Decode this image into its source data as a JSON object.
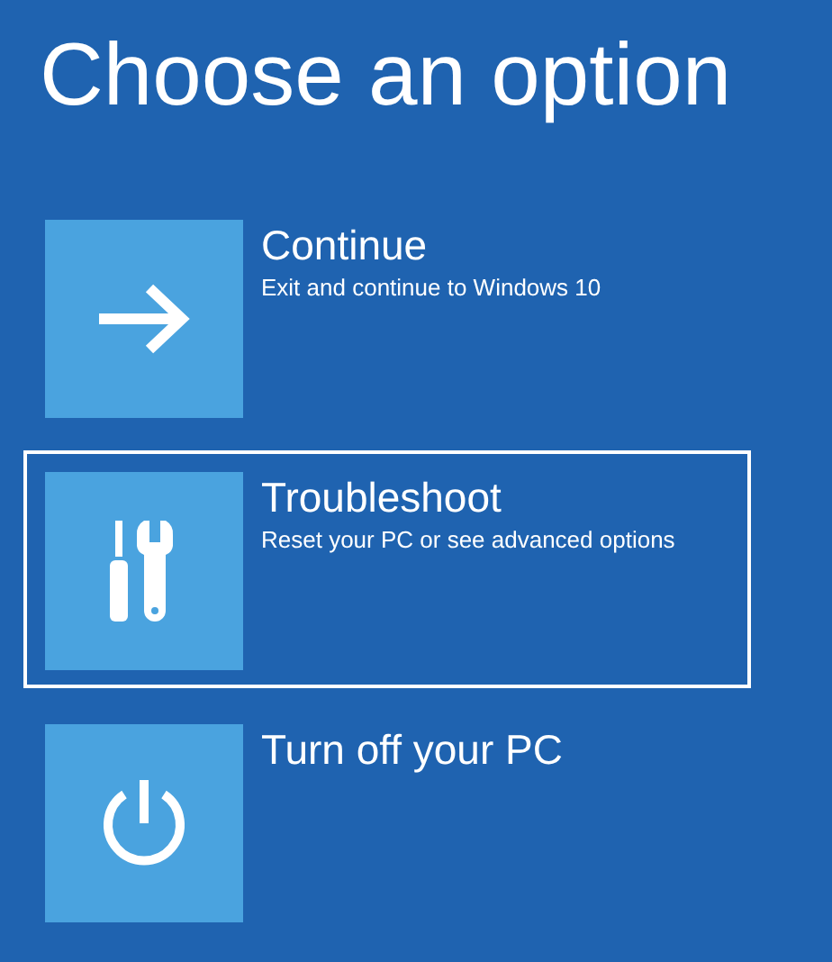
{
  "title": "Choose an option",
  "options": [
    {
      "kind": "continue",
      "label": "Continue",
      "description": "Exit and continue to Windows 10",
      "selected": false
    },
    {
      "kind": "troubleshoot",
      "label": "Troubleshoot",
      "description": "Reset your PC or see advanced options",
      "selected": true
    },
    {
      "kind": "power",
      "label": "Turn off your PC",
      "selected": false
    }
  ]
}
